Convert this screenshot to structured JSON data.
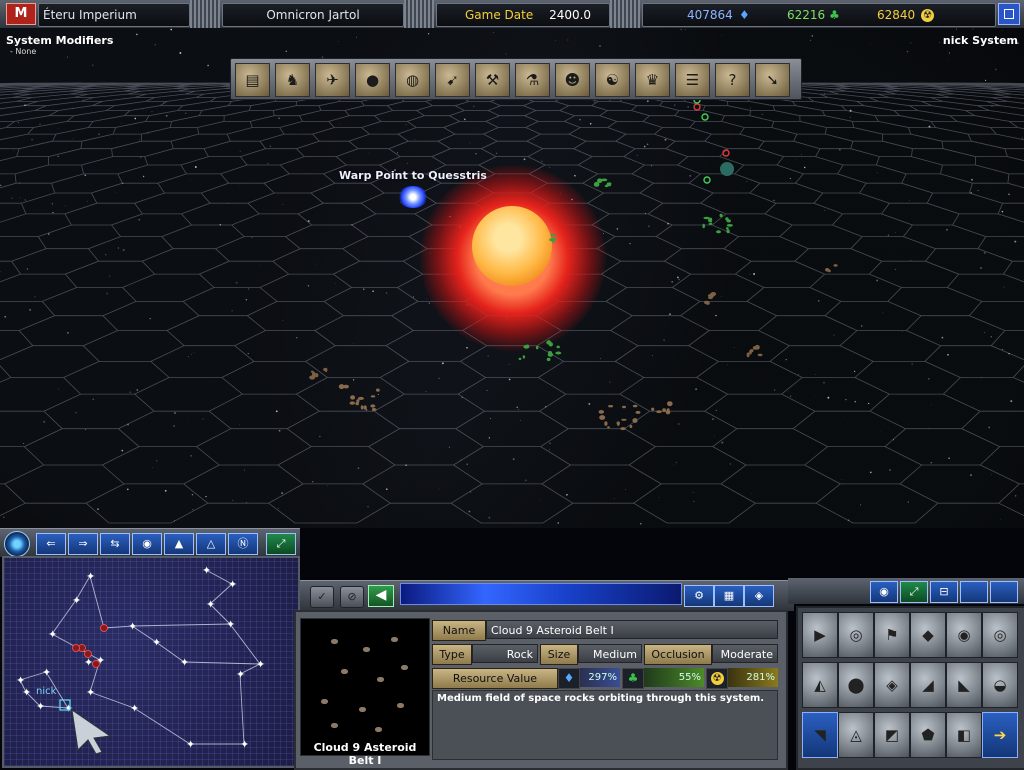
{
  "top_bar": {
    "empire": "Éteru Imperium",
    "system": "Omnicron Jartol",
    "game_date_label": "Game Date",
    "game_date": "2400.0",
    "resources": {
      "minerals": "407864",
      "organics": "62216",
      "radioactives": "62840"
    }
  },
  "viewport": {
    "modifiers_title": "System Modifiers",
    "modifiers_value": "- None",
    "system_owner": "nick System",
    "warp_label": "Warp Point to Quesstris"
  },
  "toolbar_icons": [
    "menu-icon",
    "empire-icon",
    "ships-icon",
    "planets-icon",
    "colonies-icon",
    "fleets-icon",
    "design-icon",
    "research-icon",
    "intelligence-icon",
    "diplomacy-icon",
    "empire-status-icon",
    "log-icon",
    "help-icon",
    "end-turn-icon"
  ],
  "minimap": {
    "player_label": "nick"
  },
  "info": {
    "name_label": "Name",
    "name_value": "Cloud 9 Asteroid Belt I",
    "type_label": "Type",
    "type_value": "Rock",
    "size_label": "Size",
    "size_value": "Medium",
    "occlusion_label": "Occlusion",
    "occlusion_value": "Moderate",
    "resource_label": "Resource Value",
    "mineral_pct": "297%",
    "organic_pct": "55%",
    "radioactive_pct": "281%",
    "description": "Medium field of space rocks orbiting through this system.",
    "thumb_label": "Cloud 9 Asteroid Belt I"
  },
  "colors": {
    "mineral": "#59a8ff",
    "organic": "#3ec14a",
    "radioactive": "#f2cf3c",
    "accent_blue": "#2a5fc0"
  }
}
